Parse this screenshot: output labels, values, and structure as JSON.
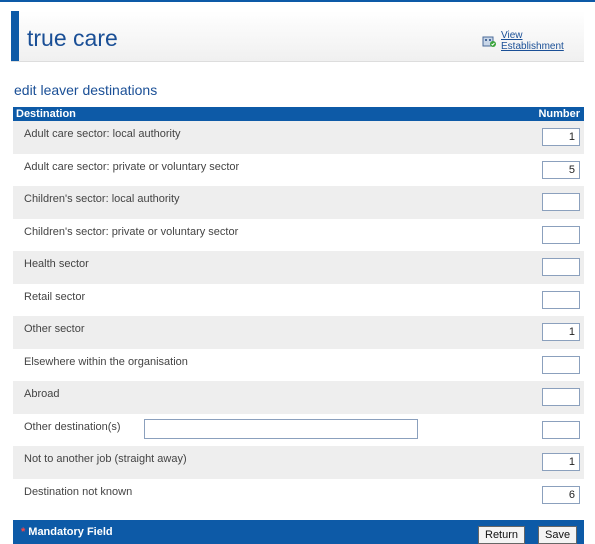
{
  "header": {
    "title": "true care",
    "view_link": "View Establishment"
  },
  "section_title": "edit leaver destinations",
  "table": {
    "col_destination": "Destination",
    "col_number": "Number",
    "rows": [
      {
        "label": "Adult care sector: local authority",
        "value": "1"
      },
      {
        "label": "Adult care sector: private or voluntary sector",
        "value": "5"
      },
      {
        "label": "Children's sector: local authority",
        "value": ""
      },
      {
        "label": "Children's sector: private or voluntary sector",
        "value": ""
      },
      {
        "label": "Health sector",
        "value": ""
      },
      {
        "label": "Retail sector",
        "value": ""
      },
      {
        "label": "Other sector",
        "value": "1"
      },
      {
        "label": "Elsewhere within the organisation",
        "value": ""
      },
      {
        "label": "Abroad",
        "value": ""
      },
      {
        "label": "Other destination(s)",
        "value": "",
        "text_value": ""
      },
      {
        "label": "Not to another job (straight away)",
        "value": "1"
      },
      {
        "label": "Destination not known",
        "value": "6"
      }
    ]
  },
  "footer": {
    "mandatory_marker": "*",
    "mandatory_text": "Mandatory Field",
    "return_label": "Return",
    "save_label": "Save"
  },
  "colors": {
    "brand_blue": "#0d5aa7",
    "title_blue": "#1a4f96",
    "row_shade": "#eeeeee",
    "mandatory_star": "#ff4444"
  },
  "icons": {
    "view_link_icon": "establishment-icon"
  }
}
